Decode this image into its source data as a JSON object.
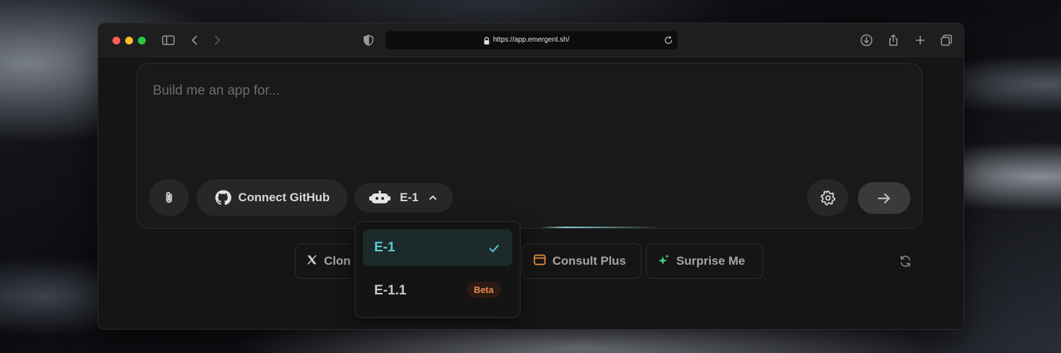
{
  "browser": {
    "url": "https://app.emergent.sh/",
    "traffic_lights": [
      "#ff5f57",
      "#febc2e",
      "#28c840"
    ],
    "icons": [
      "sidebar-icon",
      "back-icon",
      "forward-icon",
      "shield-icon",
      "lock-icon",
      "reload-icon",
      "download-icon",
      "share-icon",
      "new-tab-icon",
      "tabs-overview-icon"
    ]
  },
  "prompt": {
    "placeholder": "Build me an app for...",
    "attach_icon": "paperclip-icon",
    "github_label": "Connect GitHub",
    "model_selector": {
      "label": "E-1",
      "icon": "robot-icon",
      "expanded": true
    },
    "settings_icon": "gear-icon",
    "submit_icon": "arrow-right-icon"
  },
  "model_menu": {
    "options": [
      {
        "label": "E-1",
        "selected": true,
        "badge": ""
      },
      {
        "label": "E-1.1",
        "selected": false,
        "badge": "Beta"
      }
    ],
    "accent": "#5ccfd3"
  },
  "suggestions": {
    "chips": [
      {
        "label": "Clon",
        "icon": "x-logo-icon"
      },
      {
        "label": "Consult Plus",
        "icon": "browser-window-icon",
        "icon_color": "#f0913a"
      },
      {
        "label": "Surprise Me",
        "icon": "sparkle-icon",
        "icon_color": "#3fd07a"
      }
    ],
    "refresh_icon": "refresh-icon"
  }
}
